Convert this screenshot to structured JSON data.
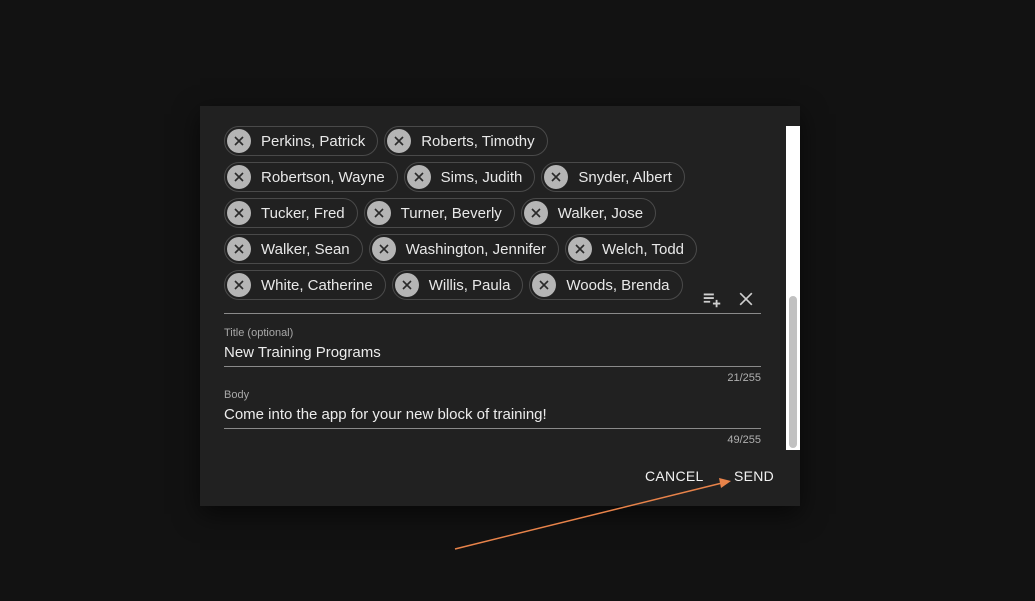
{
  "recipients": [
    {
      "name": "Perkins, Patrick"
    },
    {
      "name": "Roberts, Timothy"
    },
    {
      "name": "Robertson, Wayne"
    },
    {
      "name": "Sims, Judith"
    },
    {
      "name": "Snyder, Albert"
    },
    {
      "name": "Tucker, Fred"
    },
    {
      "name": "Turner, Beverly"
    },
    {
      "name": "Walker, Jose"
    },
    {
      "name": "Walker, Sean"
    },
    {
      "name": "Washington, Jennifer"
    },
    {
      "name": "Welch, Todd"
    },
    {
      "name": "White, Catherine"
    },
    {
      "name": "Willis, Paula"
    },
    {
      "name": "Woods, Brenda"
    }
  ],
  "recipients_actions": {
    "add_icon": "playlist-add-icon",
    "clear_icon": "close-icon"
  },
  "title_field": {
    "label": "Title (optional)",
    "value": "New Training Programs",
    "counter": "21/255"
  },
  "body_field": {
    "label": "Body",
    "value": "Come into the app for your new block of training!",
    "counter": "49/255"
  },
  "actions": {
    "cancel_label": "CANCEL",
    "send_label": "SEND"
  },
  "colors": {
    "background": "#121212",
    "dialog": "#212121",
    "arrow": "#e8834a"
  }
}
